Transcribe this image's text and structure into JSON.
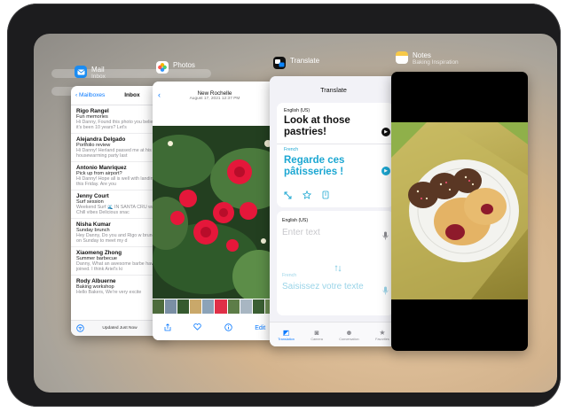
{
  "mail": {
    "app_name": "Mail",
    "app_sub": "Inbox",
    "back_label": "Mailboxes",
    "title": "Inbox",
    "messages": [
      {
        "from": "Rigo Rangel",
        "subject": "Fun memories",
        "preview": "Hi Danny, Found this photo you believe it's been 10 years? Let's"
      },
      {
        "from": "Alejandra Delgado",
        "subject": "Portfolio review",
        "preview": "Hi Danny! Herland passed me at his housewarming party last"
      },
      {
        "from": "Antonio Manriquez",
        "subject": "Pick up from airport?",
        "preview": "Hi Danny! Hope all is well with landing this Friday. Are you"
      },
      {
        "from": "Jenny Court",
        "subject": "Surf session",
        "preview": "Weekend Surf 🌊 IN SANTA CRU waves Chill vibes Delicious snac"
      },
      {
        "from": "Nisha Kumar",
        "subject": "Sunday brunch",
        "preview": "Hey Danny, Do you and Rigo w brunch on Sunday to meet my d"
      },
      {
        "from": "Xiaomeng Zhong",
        "subject": "Summer barbecue",
        "preview": "Danny, What an awesome barbe have joined. I think Ariel's ki"
      },
      {
        "from": "Rody Albuerne",
        "subject": "Baking workshop",
        "preview": "Hello Bakers, We're very excite"
      }
    ],
    "updated": "Updated Just Now"
  },
  "photos": {
    "app_name": "Photos",
    "location": "New Rochelle",
    "date": "August 17, 2021  12:37 PM",
    "edit_label": "Edit"
  },
  "translate": {
    "app_name": "Translate",
    "title": "Translate",
    "source_lang": "English (US)",
    "source_text": "Look at those pastries!",
    "target_lang": "French",
    "target_text": "Regarde ces pâtisseries !",
    "input_lang": "English (US)",
    "input_placeholder": "Enter text",
    "output_lang": "French",
    "output_placeholder": "Saisissez votre texte",
    "tabs": [
      "Translation",
      "Camera",
      "Conversation",
      "Favorites"
    ]
  },
  "notes": {
    "app_name": "Notes",
    "app_sub": "Baking Inspiration"
  },
  "colors": {
    "accent": "#0a7aff",
    "translate_blue": "#1ca7d2",
    "bezel": "#1c1c1e"
  }
}
